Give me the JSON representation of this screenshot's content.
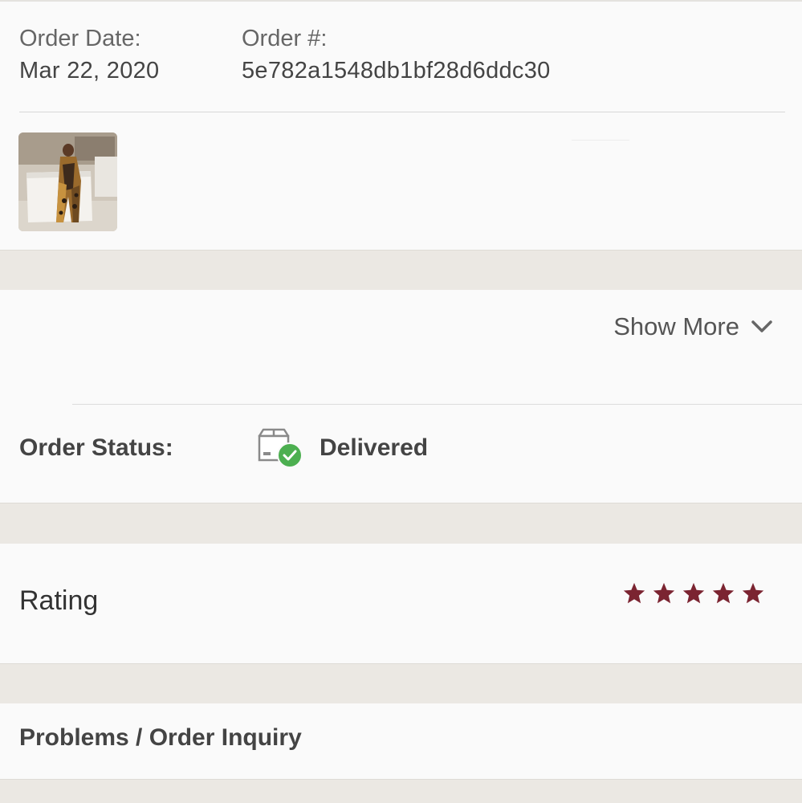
{
  "order": {
    "date_label": "Order Date:",
    "date_value": "Mar 22, 2020",
    "number_label": "Order #:",
    "number_value": "5e782a1548db1bf28d6ddc30"
  },
  "show_more": {
    "label": "Show More",
    "icon": "chevron-down-icon"
  },
  "status": {
    "label": "Order Status:",
    "value": "Delivered",
    "icon": "package-delivered-icon",
    "check_color": "#4caf50"
  },
  "rating": {
    "label": "Rating",
    "stars_filled": 5,
    "stars_total": 5,
    "star_color": "#7b2431"
  },
  "problems": {
    "label": "Problems / Order Inquiry"
  }
}
